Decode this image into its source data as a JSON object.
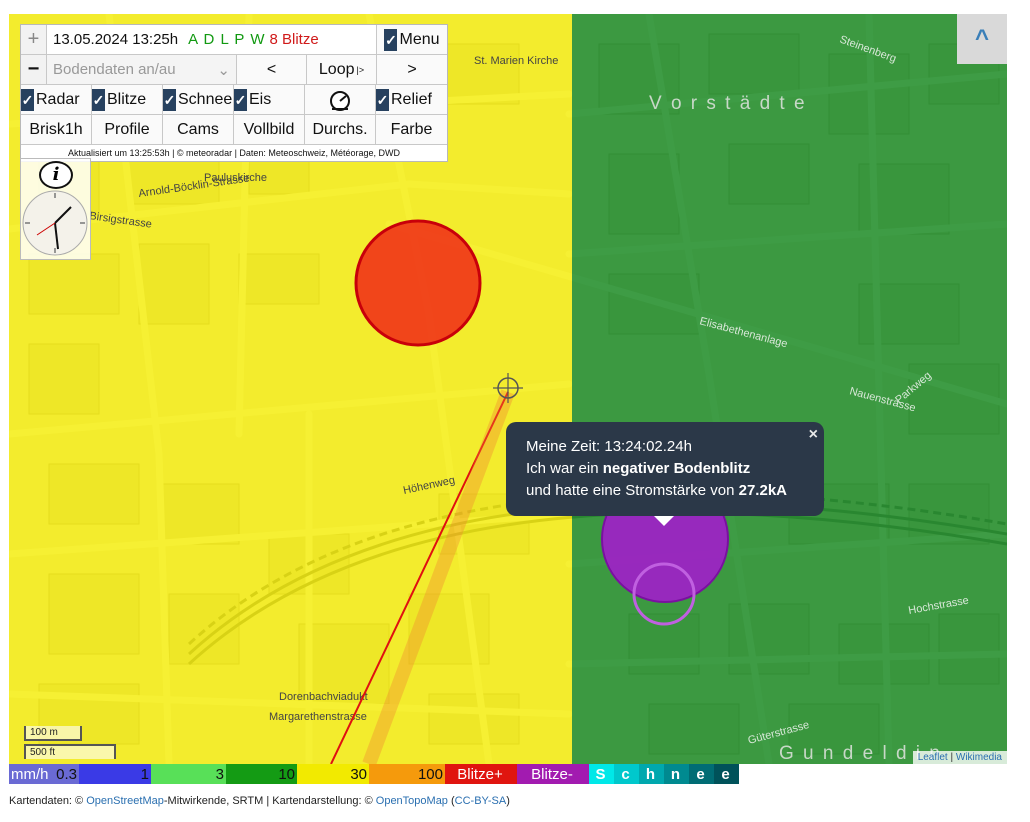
{
  "panel": {
    "plus": "+",
    "minus": "−",
    "datetime": "13.05.2024 13:25h",
    "providers": "A D L P W",
    "lightning_count": "8 Blitze",
    "menu": "Menu",
    "ground_data": "Bodendaten an/au",
    "prev": "<",
    "loop": "Loop",
    "loop_sup": "|>",
    "next": ">",
    "radar": "Radar",
    "blitze": "Blitze",
    "schnee": "Schnee",
    "eis": "Eis",
    "relief": "Relief",
    "brisk": "Brisk1h",
    "profile": "Profile",
    "cams": "Cams",
    "vollbild": "Vollbild",
    "durchs": "Durchs.",
    "farbe": "Farbe",
    "credits": "Aktualisiert um 13:25:53h | © meteoradar | Daten: Meteoschweiz, Météorage, DWD"
  },
  "info_symbol": "i",
  "up_button": "^",
  "popup": {
    "line1": "Meine Zeit: 13:24:02.24h",
    "line2_pre": "Ich war ein ",
    "line2_bold": "negativer Bodenblitz",
    "line3_pre": "und hatte eine Stromstärke von ",
    "line3_bold": "27.2kA",
    "close": "×"
  },
  "scale": {
    "metric": "100 m",
    "imperial": "500 ft"
  },
  "attribution": {
    "leaflet": "Leaflet",
    "sep": " | ",
    "wikimedia": "Wikimedia"
  },
  "map_labels": {
    "vorstaedte": "V o r s t ä d t e",
    "gundeldingen": "G u n d e l d i n",
    "st_marien": "St. Marien Kirche",
    "pauluskirche": "Pauluskirche",
    "arnold": "Arnold-Böcklin-Strasse",
    "birsigstrasse": "Birsigstrasse",
    "hochstrasse": "Hochstrasse",
    "margarethen": "Margarethenstrasse",
    "dorenbach": "Dorenbachviadukt",
    "nauen": "Nauenstrasse",
    "steinenberg": "Steinenberg",
    "elisabethen": "Elisabethenanlage",
    "gueter": "Güterstrasse",
    "parkweg": "Parkweg",
    "hohenweg": "Höhenweg"
  },
  "legend": {
    "unit": "mm/h",
    "items": [
      {
        "label": "0.3",
        "color": "#6a6ad4"
      },
      {
        "label": "1",
        "color": "#3a3ae6"
      },
      {
        "label": "3",
        "color": "#58e058"
      },
      {
        "label": "10",
        "color": "#149b14"
      },
      {
        "label": "30",
        "color": "#f2ea00"
      },
      {
        "label": "100",
        "color": "#f59a0c"
      },
      {
        "label": "Blitze+",
        "color": "#e0150f"
      },
      {
        "label": "Blitze-",
        "color": "#a21bb0"
      }
    ],
    "snow": [
      "S",
      "c",
      "h",
      "n",
      "e",
      "e"
    ],
    "snow_colors": [
      "#00e8e8",
      "#00c8cc",
      "#00a8ae",
      "#008a90",
      "#006c74",
      "#00525a"
    ]
  },
  "footer": {
    "pre": "Kartendaten: © ",
    "osm": "OpenStreetMap",
    "mid": "-Mitwirkende, SRTM | Kartendarstellung: © ",
    "otm": "OpenTopoMap",
    "open": " (",
    "cc": "CC-BY-SA",
    "close": ")"
  },
  "colors": {
    "lightning_positive": "#e0150f",
    "lightning_negative": "#a21bb0",
    "panel_check": "#27415f"
  }
}
